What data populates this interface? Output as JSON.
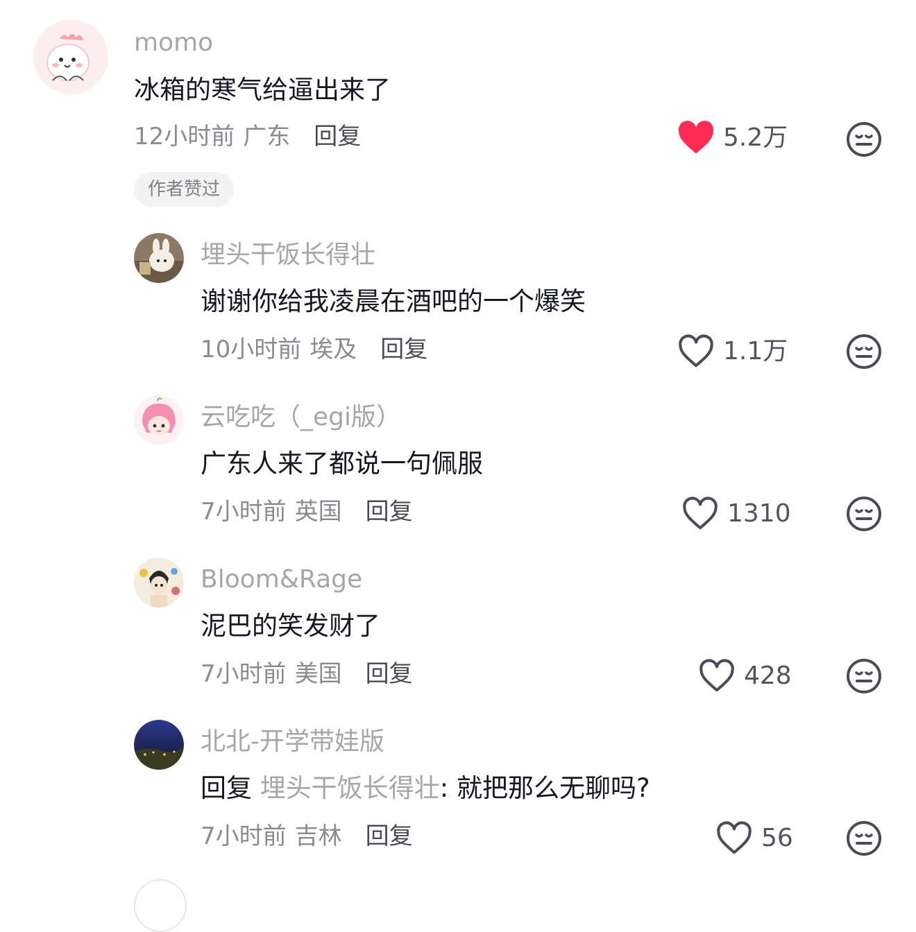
{
  "comments": [
    {
      "username": "momo",
      "text": "冰箱的寒气给逼出来了",
      "time": "12小时前",
      "location": "广东",
      "reply_label": "回复",
      "likes": "5.2万",
      "liked": true,
      "badge": "作者赞过"
    },
    {
      "username": "埋头干饭长得壮",
      "text": "谢谢你给我凌晨在酒吧的一个爆笑",
      "time": "10小时前",
      "location": "埃及",
      "reply_label": "回复",
      "likes": "1.1万",
      "liked": false
    },
    {
      "username": "云吃吃（_egi版）",
      "text": "广东人来了都说一句佩服",
      "time": "7小时前",
      "location": "英国",
      "reply_label": "回复",
      "likes": "1310",
      "liked": false
    },
    {
      "username": "Bloom&Rage",
      "text": "泥巴的笑发财了",
      "time": "7小时前",
      "location": "美国",
      "reply_label": "回复",
      "likes": "428",
      "liked": false
    },
    {
      "username": "北北-开学带娃版",
      "text_prefix": "回复",
      "text_target": "埋头干饭长得壮",
      "text": ": 就把那么无聊吗?",
      "time": "7小时前",
      "location": "吉林",
      "reply_label": "回复",
      "likes": "56",
      "liked": false
    }
  ],
  "colors": {
    "like_active": "#fe2c55",
    "secondary_text": "#a5a6aa",
    "primary_text": "#161823"
  },
  "icons": [
    "heart-filled-icon",
    "heart-outline-icon",
    "dislike-face-icon"
  ]
}
